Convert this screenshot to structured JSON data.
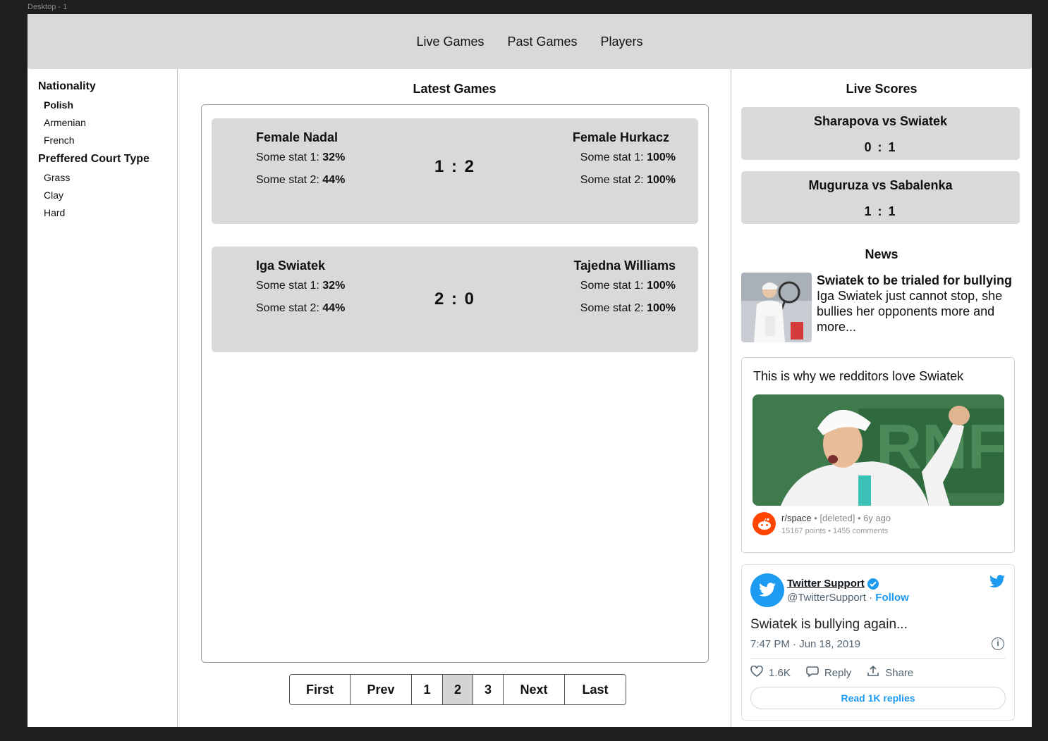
{
  "frame_label": "Desktop - 1",
  "nav": {
    "items": [
      "Live Games",
      "Past Games",
      "Players"
    ]
  },
  "sidebar": {
    "groups": [
      {
        "title": "Nationality",
        "items": [
          "Polish",
          "Armenian",
          "French"
        ],
        "active": "Polish"
      },
      {
        "title": "Preffered Court Type",
        "items": [
          "Grass",
          "Clay",
          "Hard"
        ],
        "active": null
      }
    ]
  },
  "main": {
    "title": "Latest Games",
    "games": [
      {
        "p1": {
          "name": "Female Nadal",
          "stat1_label": "Some stat 1:",
          "stat1": "32%",
          "stat2_label": "Some stat 2:",
          "stat2": "44%"
        },
        "p2": {
          "name": "Female Hurkacz",
          "stat1_label": "Some stat 1:",
          "stat1": "100%",
          "stat2_label": "Some stat 2:",
          "stat2": "100%"
        },
        "score": "1 : 2"
      },
      {
        "p1": {
          "name": "Iga Swiatek",
          "stat1_label": "Some stat 1:",
          "stat1": "32%",
          "stat2_label": "Some stat 2:",
          "stat2": "44%"
        },
        "p2": {
          "name": "Tajedna Williams",
          "stat1_label": "Some stat 1:",
          "stat1": "100%",
          "stat2_label": "Some stat 2:",
          "stat2": "100%"
        },
        "score": "2 : 0"
      }
    ],
    "pagination": [
      "First",
      "Prev",
      "1",
      "2",
      "3",
      "Next",
      "Last"
    ],
    "current_page": "2"
  },
  "right": {
    "live_title": "Live Scores",
    "live": [
      {
        "match": "Sharapova vs Swiatek",
        "score": "0 : 1"
      },
      {
        "match": "Muguruza vs Sabalenka",
        "score": "1 : 1"
      }
    ],
    "news_title": "News",
    "news": {
      "headline": "Swiatek to be trialed for bullying",
      "body": "Iga Swiatek just cannot stop, she bullies her opponents more and more..."
    },
    "reddit": {
      "title": "This is why we redditors love Swiatek",
      "subreddit": "r/space",
      "author": "[deleted]",
      "age": "6y ago",
      "points": "15167 points",
      "comments": "1455 comments"
    },
    "tweet": {
      "name": "Twitter Support",
      "handle": "@TwitterSupport",
      "follow": "Follow",
      "text": "Swiatek is bullying again...",
      "time": "7:47 PM · Jun 18, 2019",
      "likes": "1.6K",
      "reply": "Reply",
      "share": "Share",
      "replies_button": "Read 1K replies"
    }
  },
  "colors": {
    "panel_gray": "#d9d9d9",
    "twitter_blue": "#1d9bf0",
    "reddit_orange": "#ff4500"
  }
}
